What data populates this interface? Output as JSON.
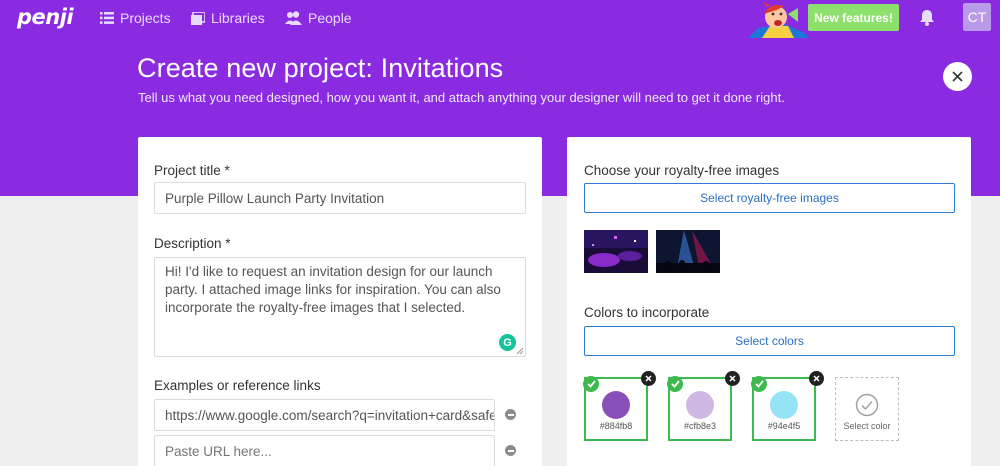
{
  "nav": {
    "logo": "penji",
    "projects_label": "Projects",
    "libraries_label": "Libraries",
    "people_label": "People",
    "new_features_label": "New features!",
    "avatar_initials": "CT"
  },
  "header": {
    "title": "Create new project: Invitations",
    "subtitle": "Tell us what you need designed, how you want it, and attach anything your designer will need to get it done right."
  },
  "form": {
    "project_title_label": "Project title *",
    "project_title_value": "Purple Pillow Launch Party Invitation",
    "description_label": "Description *",
    "description_value": "Hi! I'd like to request an invitation design for our launch party. I attached image links for inspiration. You can also incorporate the royalty-free images that I selected.",
    "examples_label": "Examples or reference links",
    "links": [
      {
        "value": "https://www.google.com/search?q=invitation+card&safe",
        "placeholder": ""
      },
      {
        "value": "",
        "placeholder": "Paste URL here..."
      }
    ]
  },
  "images": {
    "label": "Choose your royalty-free images",
    "button_label": "Select royalty-free images"
  },
  "colors": {
    "label": "Colors to incorporate",
    "button_label": "Select colors",
    "swatches": [
      {
        "hex_label": "#884fb8",
        "color": "#884fb8"
      },
      {
        "hex_label": "#cfb8e3",
        "color": "#cfb8e3"
      },
      {
        "hex_label": "#94e4f5",
        "color": "#94e4f5"
      }
    ],
    "select_color_label": "Select color"
  },
  "theme": {
    "brand_purple": "#8a2be2",
    "new_features_green": "#8ee06c",
    "check_green": "#3cba4e",
    "link_blue": "#2a7dd1"
  }
}
